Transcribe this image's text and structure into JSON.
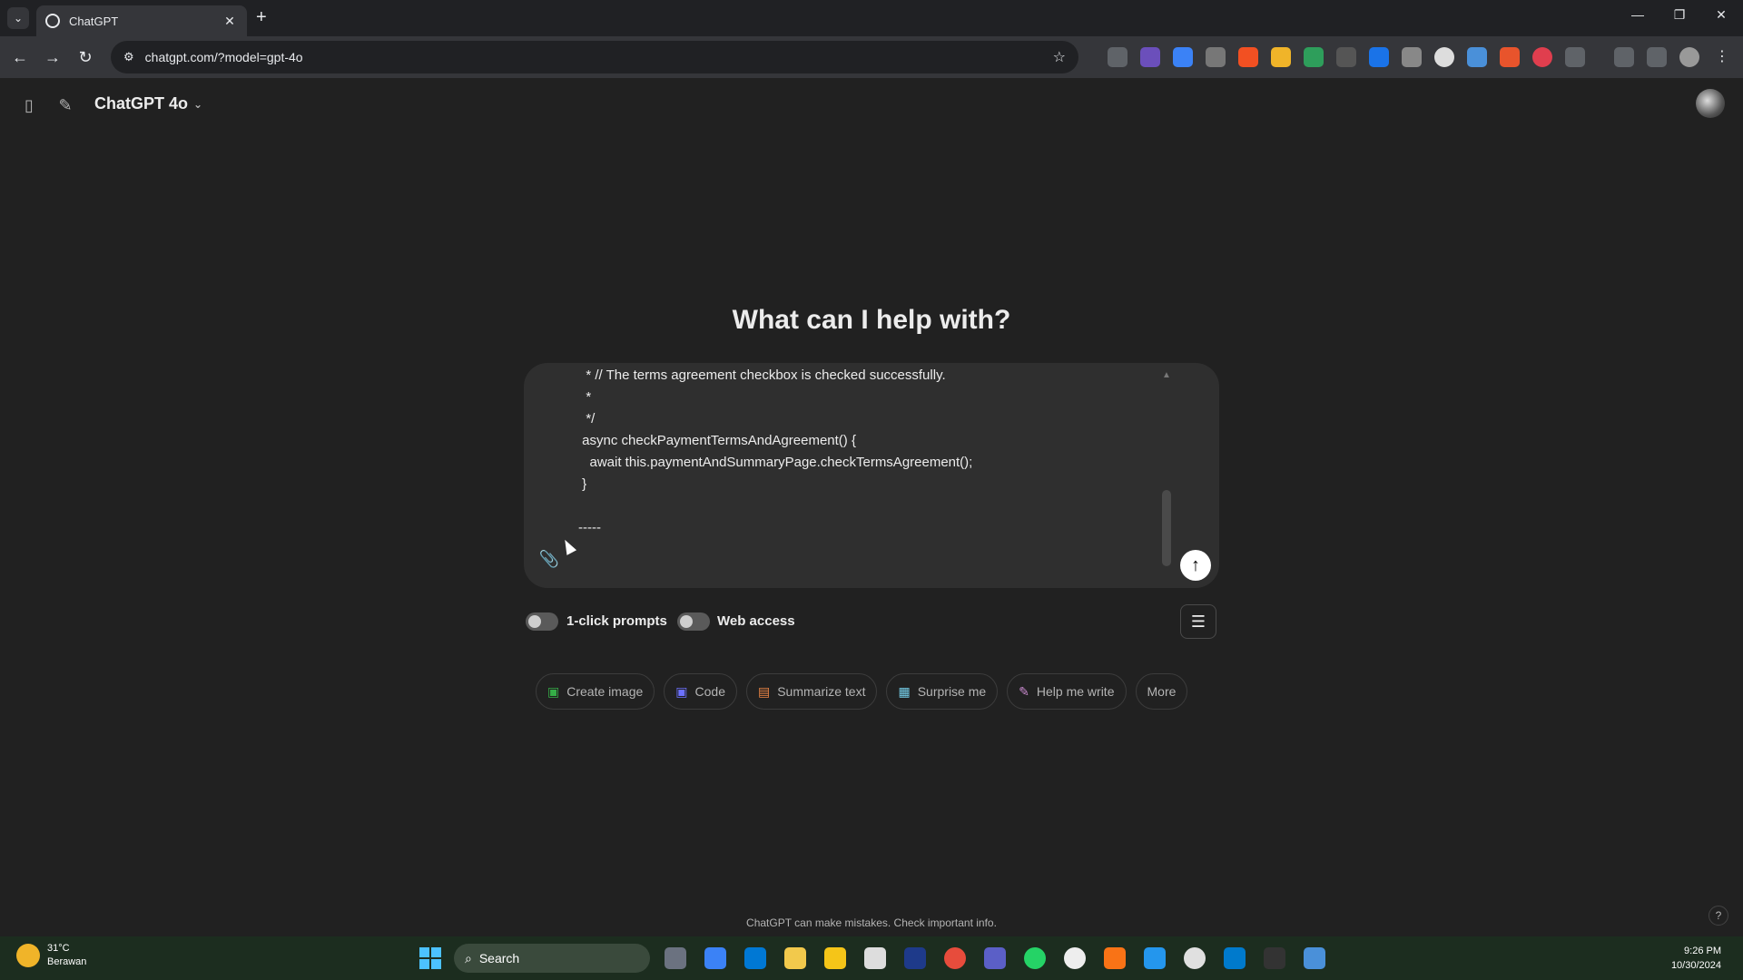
{
  "browser": {
    "tab_title": "ChatGPT",
    "url": "chatgpt.com/?model=gpt-4o",
    "new_tab_symbol": "+",
    "close_symbol": "✕"
  },
  "header": {
    "model_name": "ChatGPT 4o"
  },
  "hero": {
    "title": "What can I help with?"
  },
  "composer": {
    "code_lines": "  * // The terms agreement checkbox is checked successfully.\n  *\n  */\n async checkPaymentTermsAndAgreement() {\n   await this.paymentAndSummaryPage.checkTermsAgreement();\n }\n\n-----"
  },
  "toggles": {
    "one_click_label": "1-click prompts",
    "web_access_label": "Web access"
  },
  "chips": [
    {
      "label": "Create image",
      "icon": "image-icon",
      "color": "#35ae47"
    },
    {
      "label": "Code",
      "icon": "code-icon",
      "color": "#6c71ff"
    },
    {
      "label": "Summarize text",
      "icon": "document-icon",
      "color": "#ea8444"
    },
    {
      "label": "Surprise me",
      "icon": "gift-icon",
      "color": "#76d0eb"
    },
    {
      "label": "Help me write",
      "icon": "pen-icon",
      "color": "#cb8bd0"
    },
    {
      "label": "More",
      "icon": "",
      "color": ""
    }
  ],
  "disclaimer": "ChatGPT can make mistakes. Check important info.",
  "taskbar": {
    "weather_temp": "31°C",
    "weather_desc": "Berawan",
    "search_label": "Search",
    "time": "9:26 PM",
    "date": "10/30/2024"
  }
}
